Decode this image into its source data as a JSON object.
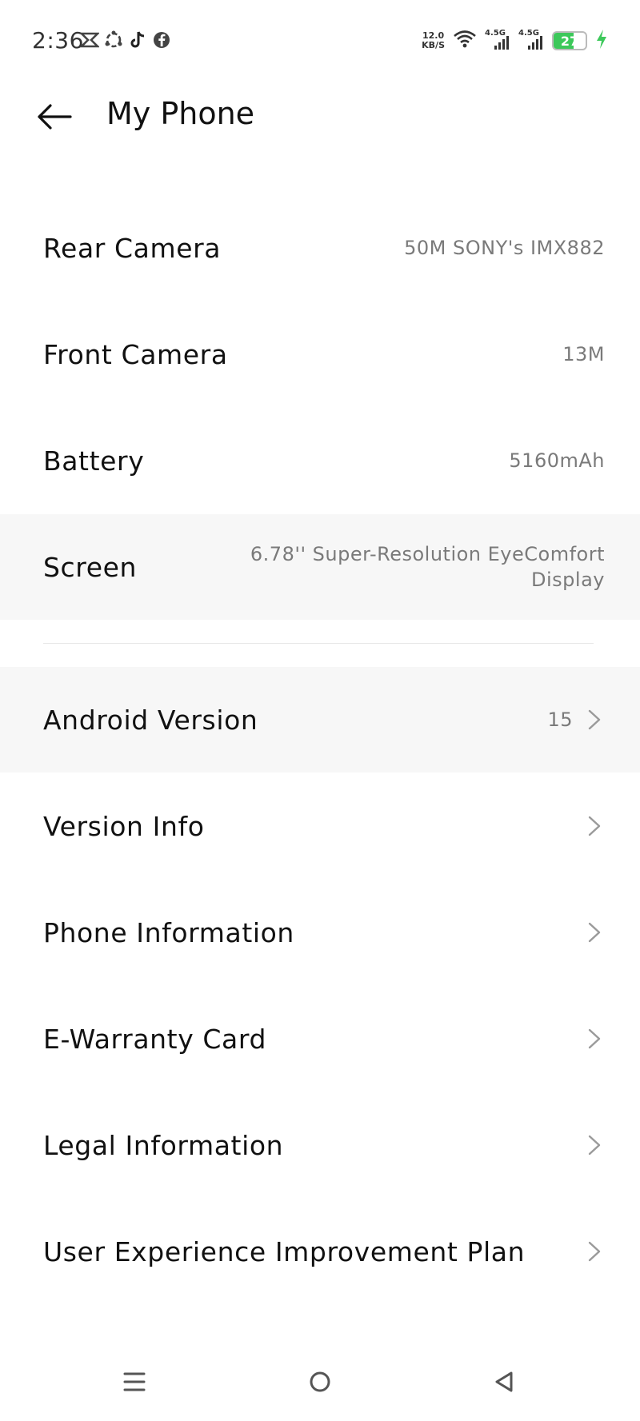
{
  "status_bar": {
    "time": "2:36",
    "net_speed_value": "12.0",
    "net_speed_unit": "KB/S",
    "sim1_label": "4.5G",
    "sim2_label": "4.5G",
    "battery_level": "27",
    "battery_fraction": 0.27,
    "battery_color": "#3cc85a",
    "charging_color": "#3cc85a",
    "app_icons": [
      "capcut-icon",
      "sync-icon",
      "tiktok-icon",
      "facebook-icon"
    ]
  },
  "header": {
    "title": "My Phone"
  },
  "specs": [
    {
      "label": "Rear Camera",
      "value": "50M SONY's IMX882"
    },
    {
      "label": "Front Camera",
      "value": "13M"
    },
    {
      "label": "Battery",
      "value": "5160mAh"
    },
    {
      "label": "Screen",
      "value": "6.78'' Super-Resolution EyeComfort Display"
    }
  ],
  "menu": [
    {
      "label": "Android Version",
      "value": "15"
    },
    {
      "label": "Version Info"
    },
    {
      "label": "Phone Information"
    },
    {
      "label": "E-Warranty Card"
    },
    {
      "label": "Legal Information"
    },
    {
      "label": "User Experience Improvement Plan"
    }
  ]
}
